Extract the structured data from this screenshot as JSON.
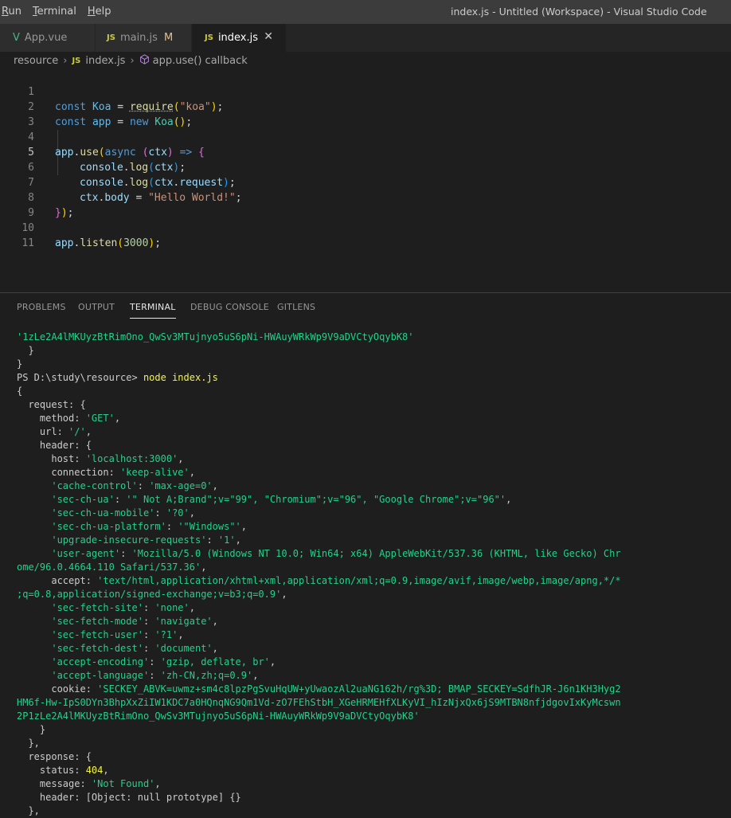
{
  "menu": {
    "run": "Run",
    "terminal": "Terminal",
    "help": "Help"
  },
  "window_title": "index.js - Untitled (Workspace) - Visual Studio Code",
  "tabs": [
    {
      "label": "App.vue",
      "icon": "vue-icon",
      "modified": ""
    },
    {
      "label": "main.js",
      "icon": "js-icon",
      "modified": "M"
    },
    {
      "label": "index.js",
      "icon": "js-icon",
      "modified": "",
      "close": "✕"
    }
  ],
  "js_badge": "JS",
  "vue_badge": "V",
  "breadcrumb": {
    "folder": "resource",
    "file": "index.js",
    "symbol": "app.use() callback"
  },
  "editor": {
    "line_numbers": [
      "1",
      "2",
      "3",
      "4",
      "5",
      "6",
      "7",
      "8",
      "9",
      "10",
      "11"
    ],
    "current_line": "5",
    "code": {
      "l1": {
        "kw": "const",
        "var": "Koa",
        "op": "=",
        "fn": "require",
        "str": "\"koa\"",
        "end": ";"
      },
      "l2": {
        "kw": "const",
        "var": "app",
        "op": "=",
        "kw2": "new",
        "cls": "Koa",
        "end": ";"
      },
      "l4": {
        "obj": "app",
        "method": "use",
        "kw": "async",
        "param": "ctx",
        "arrow": "=>"
      },
      "l5": {
        "obj": "console",
        "method": "log",
        "arg": "ctx"
      },
      "l6": {
        "obj": "console",
        "method": "log",
        "arg": "ctx",
        "prop": "request"
      },
      "l7": {
        "obj": "ctx",
        "prop": "body",
        "op": "=",
        "str": "\"Hello World!\""
      },
      "l10": {
        "obj": "app",
        "method": "listen",
        "num": "3000"
      }
    }
  },
  "panel_tabs": [
    "PROBLEMS",
    "OUTPUT",
    "TERMINAL",
    "DEBUG CONSOLE",
    "GITLENS"
  ],
  "active_panel_tab": "TERMINAL",
  "terminal": {
    "top_token": "'1zLe2A4lMKUyzBtRimOno_QwSv3MTujnyo5uS6pNi-HWAuyWRkWp9V9aDVCtyOqybK8'",
    "prompt": "PS D:\\study\\resource> ",
    "command": "node index.js",
    "method": "'GET'",
    "url": "'/'",
    "host": "'localhost:3000'",
    "connection": "'keep-alive'",
    "cache_control_key": "'cache-control'",
    "cache_control": "'max-age=0'",
    "sec_ch_ua_key": "'sec-ch-ua'",
    "sec_ch_ua": "'\" Not A;Brand\";v=\"99\", \"Chromium\";v=\"96\", \"Google Chrome\";v=\"96\"'",
    "sec_ch_ua_mobile_key": "'sec-ch-ua-mobile'",
    "sec_ch_ua_mobile": "'?0'",
    "sec_ch_ua_platform_key": "'sec-ch-ua-platform'",
    "sec_ch_ua_platform": "'\"Windows\"'",
    "upgrade_key": "'upgrade-insecure-requests'",
    "upgrade": "'1'",
    "user_agent_key": "'user-agent'",
    "user_agent_1": "'Mozilla/5.0 (Windows NT 10.0; Win64; x64) AppleWebKit/537.36 (KHTML, like Gecko) Chr",
    "user_agent_2": "ome/96.0.4664.110 Safari/537.36'",
    "accept_1": "'text/html,application/xhtml+xml,application/xml;q=0.9,image/avif,image/webp,image/apng,*/*",
    "accept_2": ";q=0.8,application/signed-exchange;v=b3;q=0.9'",
    "sec_fetch_site_key": "'sec-fetch-site'",
    "sec_fetch_site": "'none'",
    "sec_fetch_mode_key": "'sec-fetch-mode'",
    "sec_fetch_mode": "'navigate'",
    "sec_fetch_user_key": "'sec-fetch-user'",
    "sec_fetch_user": "'?1'",
    "sec_fetch_dest_key": "'sec-fetch-dest'",
    "sec_fetch_dest": "'document'",
    "accept_encoding_key": "'accept-encoding'",
    "accept_encoding": "'gzip, deflate, br'",
    "accept_language_key": "'accept-language'",
    "accept_language": "'zh-CN,zh;q=0.9'",
    "cookie_1": "'SECKEY_ABVK=uwmz+sm4c8lpzPgSvuHqUW+yUwaozAl2uaNG162h/rg%3D; BMAP_SECKEY=SdfhJR-J6n1KH3Hyg2",
    "cookie_2": "HM6f-Hw-IpS0DYn3BhpXxZiIW1KDC7a0HQnqNG9Qm1Vd-zO7FEhStbH_XGeHRMEHfXLKyVI_hIzNjxQx6jS9MTBN8nfjdgovIxKyMcswn",
    "cookie_3": "2P1zLe2A4lMKUyzBtRimOno_QwSv3MTujnyo5uS6pNi-HWAuyWRkWp9V9aDVCtyOqybK8'",
    "status": "404",
    "message": "'Not Found'",
    "response_header": "[Object: null prototype] {}"
  }
}
